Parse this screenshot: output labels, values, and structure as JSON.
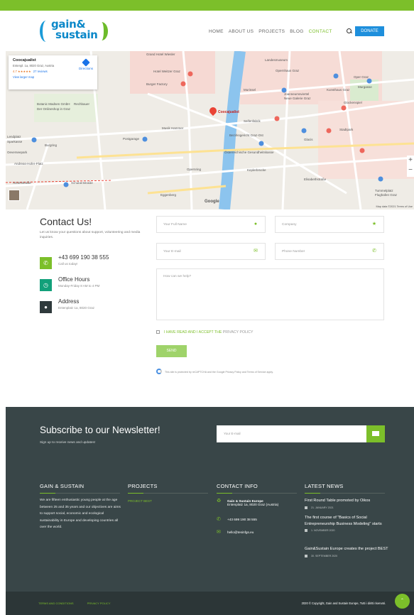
{
  "header": {
    "logo_line1": "gain&",
    "logo_line2": "sustain",
    "nav": [
      {
        "label": "HOME"
      },
      {
        "label": "ABOUT US"
      },
      {
        "label": "PROJECTS"
      },
      {
        "label": "BLOG"
      },
      {
        "label": "CONTACT"
      }
    ],
    "donate_label": "DONATE",
    "accent": "#7cbf2a",
    "donate_color": "#1e8fdc"
  },
  "map": {
    "place_name": "Coocajualist",
    "place_address": "Entenpl. 1a, 8020 Graz, Austria",
    "rating": "4.7 ★★★★★",
    "reviews": "27 reviews",
    "larger_map": "View larger map",
    "directions": "Directions",
    "pin_label": "Coocajualist",
    "labels": [
      "Grand Hotel Wiesler",
      "Landesmuseum",
      "Hotel Weitzer Graz",
      "Burger Factory",
      "Opernhaus Graz",
      "Oper Graz",
      "Murinsel",
      "Kunsthaus Graz",
      "Joanneumsviertel",
      "Neue Galerie Graz",
      "Murgasse",
      "Glockenspiel",
      "Botanic Madsen GmbH",
      "Der Onlineshop in Graz",
      "Rechbauer",
      "Musik Hammer",
      "Bezirksgericht Graz-Ost",
      "Seifenfabrik",
      "Postgarage",
      "Österreichische Gesundheitskasse",
      "Lendplatz",
      "Sparkasse",
      "Burgring",
      "Oeverseepark",
      "Andreas-Hofer-Platz",
      "Schubertstraße",
      "Annenstraße",
      "Eggenberg",
      "Glacis",
      "Stadtpark",
      "Keplerbrücke",
      "Tummelplatz",
      "Flughafen Graz",
      "Opernring",
      "Elisabethstraße"
    ],
    "google": "Google",
    "legal": "Map data ©2021  Terms of Use",
    "zoom_in": "+",
    "zoom_out": "−"
  },
  "contact": {
    "title": "Contact Us!",
    "description": "Let us know your questions about support, volunteering and media inquiries.",
    "phone": "+43 699 190 38 555",
    "phone_sub": "Call us today!",
    "hours_title": "Office Hours",
    "hours_sub": "Monday-Friday 8 AM to 4 PM",
    "address_title": "Address",
    "address_sub": "Entenplatz 1a, 8020 Graz",
    "form": {
      "name_placeholder": "Your Full Name",
      "company_placeholder": "Company",
      "email_placeholder": "Your E-mail",
      "phone_placeholder": "Phone Number",
      "message_placeholder": "How can we help?",
      "privacy_text": "I HAVE READ AND I ACCEPT THE",
      "privacy_link": "PRIVACY POLICY",
      "send_label": "SEND",
      "recaptcha": "This site is protected by reCAPTCHA and the Google Privacy Policy and Terms of Service apply."
    },
    "icon_colors": [
      "#7cbf2a",
      "#12a07a",
      "#2f3a3c"
    ]
  },
  "footer": {
    "newsletter_title": "Subscribe to our Newsletter!",
    "newsletter_sub": "Sign up to receive news and updates!",
    "newsletter_placeholder": "Your E-mail",
    "col1_head": "GAIN & SUSTAIN",
    "col1_text": "We are fifteen enthusiastic young people at the age between 25 and 35 years and our objectives are aims to support social, economic and ecological sustainability in Europe and developing countries all over the world.",
    "col2_head": "PROJECTS",
    "col2_link": "PROJECT BEST",
    "col3_head": "CONTACT INFO",
    "contact_org": "Gain & Sustain Europe",
    "contact_addr": "Entenplatz 1a, 8020 Graz (Austria)",
    "contact_phone": "+43 699 190 38 555",
    "contact_email": "hello@tesinfgs.eu",
    "col4_head": "LATEST NEWS",
    "news": [
      {
        "title": "First Round Table promoted by Oikos",
        "date": "21. JANUARY 2021"
      },
      {
        "title": "The first course of \"Basics of Social Entrepreneurship Business Modeling\" starts",
        "date": "1. NOVEMBER 2020"
      },
      {
        "title": "Gain&Sustain Europe creates the project BEST",
        "date": "30. SEPTEMBER 2020"
      }
    ],
    "bottom_links": [
      "TERMS AND CONDITIONS",
      "PRIVACY POLICY"
    ],
    "copyright": "2020 © Copyright, Gain and Sustain Europe, Tutti i diritti riservati."
  }
}
